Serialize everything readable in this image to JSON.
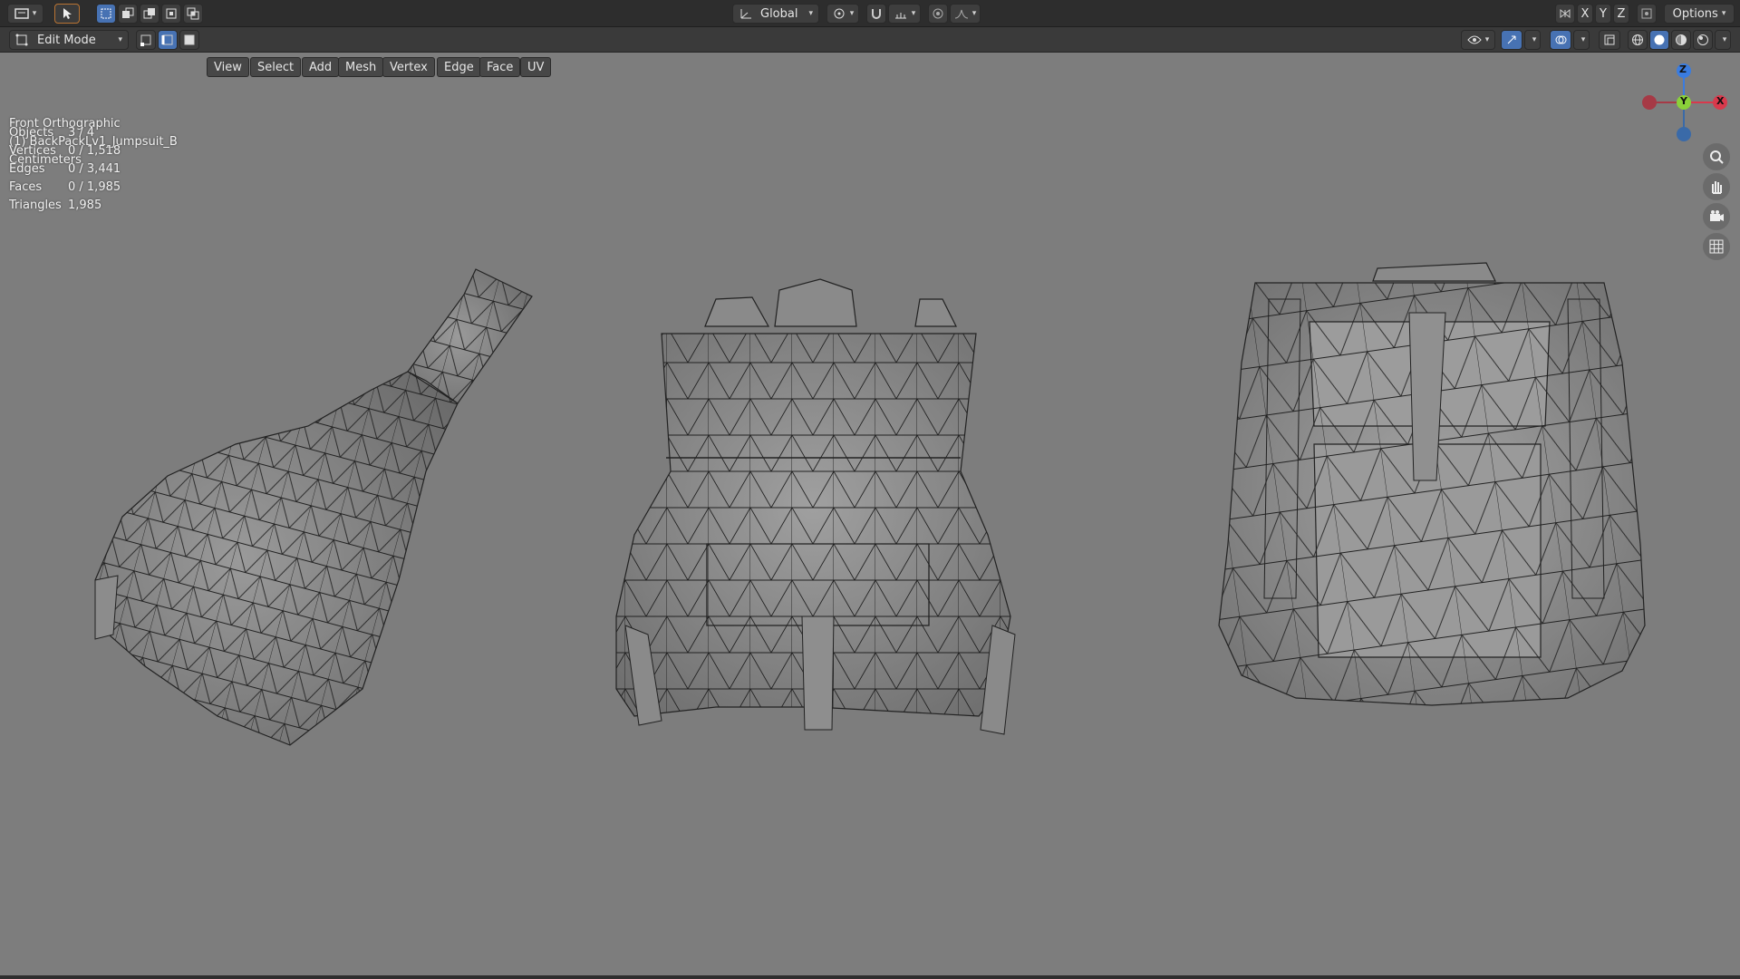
{
  "header": {
    "orientation_label": "Global",
    "options_label": "Options",
    "axis_x": "X",
    "axis_y": "Y",
    "axis_z": "Z"
  },
  "toolbar": {
    "mode_label": "Edit Mode",
    "menus": [
      "View",
      "Select",
      "Add",
      "Mesh",
      "Vertex",
      "Edge",
      "Face",
      "UV"
    ]
  },
  "viewport": {
    "view_name": "Front Orthographic",
    "object_name": "(1) BackPackLv1_Jumpsuit_B",
    "units": "Centimeters",
    "stats": [
      {
        "label": "Objects",
        "value": "3 / 4"
      },
      {
        "label": "Vertices",
        "value": "0 / 1,518"
      },
      {
        "label": "Edges",
        "value": "0 / 3,441"
      },
      {
        "label": "Faces",
        "value": "0 / 1,985"
      },
      {
        "label": "Triangles",
        "value": "1,985"
      }
    ]
  },
  "gizmo": {
    "z": "Z",
    "y": "Y",
    "x": "X"
  },
  "colors": {
    "background": "#7d7d7d",
    "header": "#2d2d2d",
    "active": "#4772b3",
    "axis_x": "#d9394c",
    "axis_y": "#8ad13a",
    "axis_z": "#3a7ce0"
  }
}
